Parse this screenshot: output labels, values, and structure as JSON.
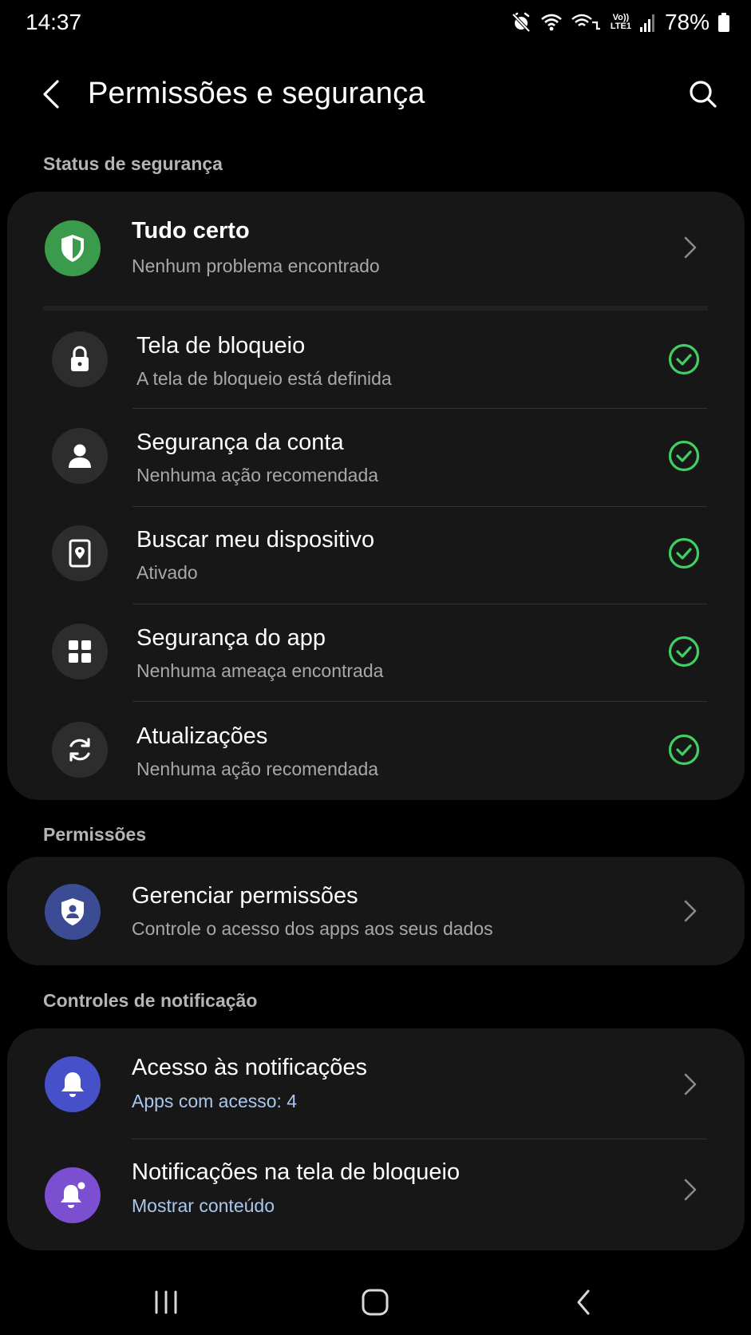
{
  "status_bar": {
    "time": "14:37",
    "battery_percent": "78%",
    "network_label_top": "Vo))",
    "network_label_bottom": "LTE1"
  },
  "app_bar": {
    "title": "Permissões e segurança"
  },
  "security_status": {
    "header": "Status de segurança",
    "summary": {
      "title": "Tudo certo",
      "subtitle": "Nenhum problema encontrado",
      "icon": "shield-icon"
    },
    "items": [
      {
        "title": "Tela de bloqueio",
        "subtitle": "A tela de bloqueio está definida",
        "icon": "lock-icon",
        "status": "ok"
      },
      {
        "title": "Segurança da conta",
        "subtitle": "Nenhuma ação recomendada",
        "icon": "person-icon",
        "status": "ok"
      },
      {
        "title": "Buscar meu dispositivo",
        "subtitle": "Ativado",
        "icon": "find-device-icon",
        "status": "ok"
      },
      {
        "title": "Segurança do app",
        "subtitle": "Nenhuma ameaça encontrada",
        "icon": "apps-grid-icon",
        "status": "ok"
      },
      {
        "title": "Atualizações",
        "subtitle": "Nenhuma ação recomendada",
        "icon": "refresh-icon",
        "status": "ok"
      }
    ]
  },
  "permissions": {
    "header": "Permissões",
    "items": [
      {
        "title": "Gerenciar permissões",
        "subtitle": "Controle o acesso dos apps aos seus dados",
        "icon": "permission-shield-icon"
      }
    ]
  },
  "notification_controls": {
    "header": "Controles de notificação",
    "items": [
      {
        "title": "Acesso às notificações",
        "subtitle": "Apps com acesso: 4",
        "icon": "bell-icon"
      },
      {
        "title": "Notificações na tela de bloqueio",
        "subtitle": "Mostrar conteúdo",
        "icon": "bell-badge-icon"
      }
    ]
  },
  "colors": {
    "background": "#000000",
    "card": "#171717",
    "success_green": "#3fcf63",
    "summary_icon_bg": "#3a9b4d",
    "permission_icon_bg": "#3b4c94",
    "notification_icon_bg": "#4550c9",
    "lockscreen_notification_icon_bg": "#7b4fd0",
    "accent_blue_text": "#a9c7ee"
  }
}
